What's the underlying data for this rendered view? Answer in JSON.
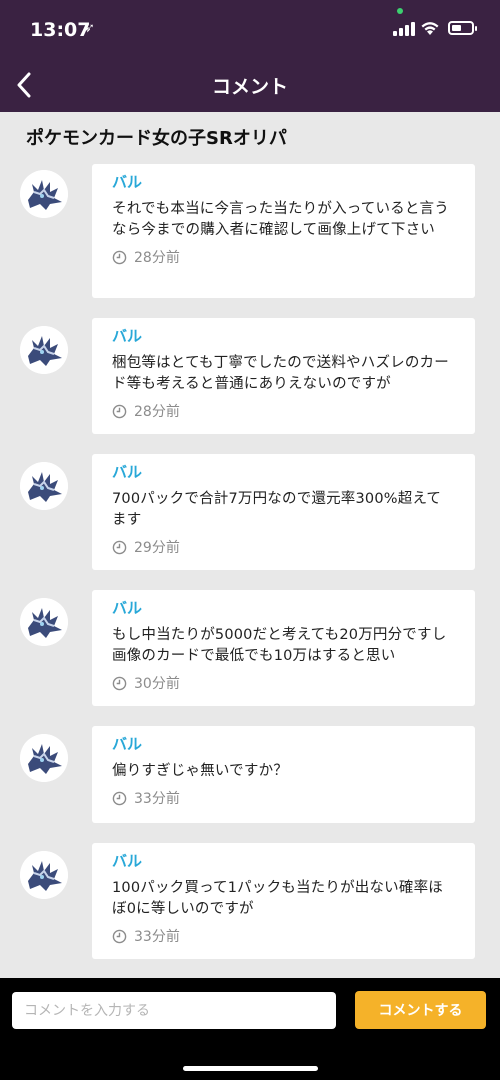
{
  "status_bar": {
    "time": "13:07",
    "location_glyph": "➶"
  },
  "nav": {
    "title": "コメント",
    "back_icon": "chevron-left-icon"
  },
  "post": {
    "title": "ポケモンカード女の子SRオリパ"
  },
  "comments": [
    {
      "author": "バル",
      "text": "それでも本当に今言った当たりが入っていると言うなら今までの購入者に確認して画像上げて下さい",
      "time": "28分前"
    },
    {
      "author": "バル",
      "text": "梱包等はとても丁寧でしたので送料やハズレのカード等も考えると普通にありえないのですが",
      "time": "28分前"
    },
    {
      "author": "バル",
      "text": "700パックで合計7万円なので還元率300%超えてます",
      "time": "29分前"
    },
    {
      "author": "バル",
      "text": "もし中当たりが5000だと考えても20万円分ですし画像のカードで最低でも10万はすると思い",
      "time": "30分前"
    },
    {
      "author": "バル",
      "text": "偏りすぎじゃ無いですか？",
      "time": "33分前"
    },
    {
      "author": "バル",
      "text": "100パック買って1パックも当たりが出ない確率ほぼ0に等しいのですが",
      "time": "33分前"
    }
  ],
  "input": {
    "placeholder": "コメントを入力する",
    "value": ""
  },
  "submit": {
    "label": "コメントする"
  },
  "colors": {
    "header": "#3a2242",
    "author": "#29a8d8",
    "button": "#f5b229",
    "background": "#e8e8e8"
  }
}
